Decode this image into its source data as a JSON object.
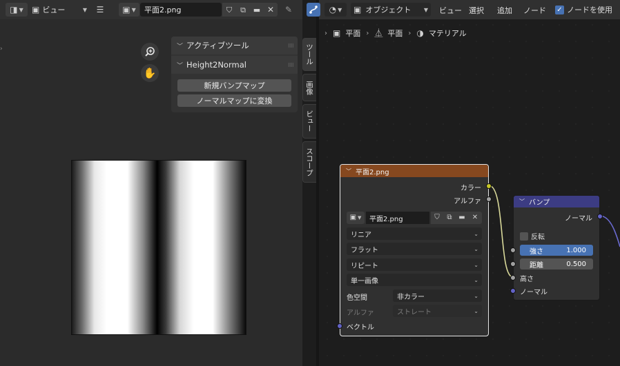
{
  "image_editor": {
    "header": {
      "view_menu_label": "ビュー",
      "image_name": "平面2.png"
    },
    "sidebar": {
      "panels": [
        {
          "title": "アクティブツール"
        },
        {
          "title": "Height2Normal",
          "buttons": [
            "新規バンプマップ",
            "ノーマルマップに変換"
          ]
        }
      ],
      "tabs": [
        "ツール",
        "画像",
        "ビュー",
        "スコープ"
      ]
    },
    "image": {
      "description_colors": {
        "dark": "#000000",
        "light": "#ffffff"
      }
    }
  },
  "node_editor": {
    "header": {
      "object_mode": "オブジェクト",
      "menus": [
        "ビュー",
        "選択",
        "追加",
        "ノード"
      ],
      "use_nodes_label": "ノードを使用",
      "use_nodes_checked": true
    },
    "breadcrumb": [
      "平面",
      "平面",
      "マテリアル"
    ],
    "image_node": {
      "title": "平面2.png",
      "outputs": [
        "カラー",
        "アルファ"
      ],
      "image_name": "平面2.png",
      "interpolation": "リニア",
      "projection": "フラット",
      "extension": "リピート",
      "source": "単一画像",
      "color_space_label": "色空間",
      "color_space": "非カラー",
      "alpha_label": "アルファ",
      "alpha_mode": "ストレート",
      "input": "ベクトル"
    },
    "bump_node": {
      "title": "バンプ",
      "output": "ノーマル",
      "invert_label": "反転",
      "strength_label": "強さ",
      "strength_value": "1.000",
      "distance_label": "距離",
      "distance_value": "0.500",
      "height_label": "高さ",
      "normal_label": "ノーマル"
    }
  },
  "colors": {
    "accent": "#4772b3",
    "image_node_header": "#86481f",
    "bump_node_header": "#3c3c83",
    "socket_color": "#c7c729",
    "socket_float": "#a1a1a1",
    "socket_vector": "#6363c7"
  }
}
